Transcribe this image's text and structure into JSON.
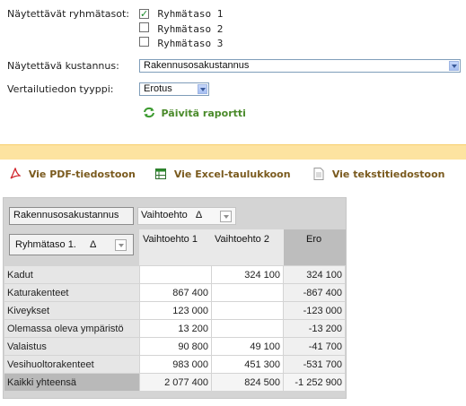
{
  "filters": {
    "groups_label": "Näytettävät ryhmätasot:",
    "groups": [
      {
        "label": "Ryhmätaso 1",
        "checked": true
      },
      {
        "label": "Ryhmätaso 2",
        "checked": false
      },
      {
        "label": "Ryhmätaso 3",
        "checked": false
      }
    ],
    "cost_label": "Näytettävä kustannus:",
    "cost_value": "Rakennusosakustannus",
    "compare_label": "Vertailutiedon tyyppi:",
    "compare_value": "Erotus",
    "refresh_label": "Päivitä raportti"
  },
  "export": {
    "pdf": "Vie PDF-tiedostoon",
    "excel": "Vie Excel-taulukkoon",
    "text": "Vie tekstitiedostoon"
  },
  "pivot": {
    "data_field": "Rakennusosakustannus",
    "column_field": "Vaihtoehto",
    "sort_symbol": "Δ",
    "row_field": "Ryhmätaso 1.",
    "columns": [
      "Vaihtoehto 1",
      "Vaihtoehto 2",
      "Ero"
    ],
    "rows": [
      {
        "label": "Kadut",
        "values": [
          "",
          "324 100",
          "324 100"
        ]
      },
      {
        "label": "Katurakenteet",
        "values": [
          "867 400",
          "",
          "-867 400"
        ]
      },
      {
        "label": "Kiveykset",
        "values": [
          "123 000",
          "",
          "-123 000"
        ]
      },
      {
        "label": "Olemassa oleva ympäristö",
        "values": [
          "13 200",
          "",
          "-13 200"
        ]
      },
      {
        "label": "Valaistus",
        "values": [
          "90 800",
          "49 100",
          "-41 700"
        ]
      },
      {
        "label": "Vesihuoltorakenteet",
        "values": [
          "983 000",
          "451 300",
          "-531 700"
        ]
      }
    ],
    "total": {
      "label": "Kaikki yhteensä",
      "values": [
        "2 077 400",
        "824 500",
        "-1 252 900"
      ]
    }
  }
}
